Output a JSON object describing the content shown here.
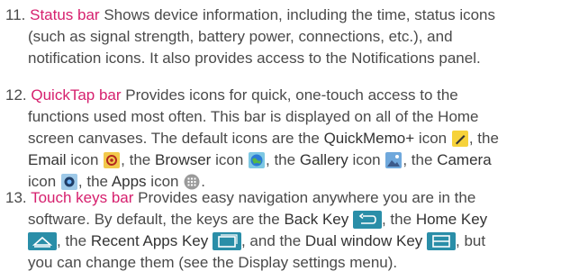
{
  "items": [
    {
      "number": "11.",
      "term": "Status bar",
      "lines": [
        "Shows device information, including the time, status icons",
        "(such as signal strength, battery power, connections, etc.), and",
        "notification icons. It also provides access to the Notifications panel."
      ]
    },
    {
      "number": "12.",
      "term": "QuickTap bar",
      "line1": "Provides icons for quick, one-touch access to the",
      "line2": "functions used most often. This bar is displayed on all of the Home",
      "line3": "screen canvases. The default icons are the",
      "quickmemo": "QuickMemo+",
      "icon_word": "icon",
      "the1": ", the",
      "email": "Email",
      "the2": ", the",
      "browser": "Browser",
      "the3": ", the",
      "gallery": "Gallery",
      "the4": ", the",
      "camera": "Camera",
      "the5": ", the",
      "apps": "Apps",
      "period": "."
    },
    {
      "number": "13.",
      "term": "Touch keys bar",
      "line1": "Provides easy navigation anywhere you are in the",
      "line2_start": "software. By default, the keys are the",
      "back_key": "Back Key",
      "the_a": ", the",
      "home_key": "Home Key",
      "the_b": ", the",
      "recent_key": "Recent Apps Key",
      "and_the": ", and the",
      "dual_key": "Dual window Key",
      "but": ", but",
      "line5": "you can change them (see the Display settings menu)."
    }
  ],
  "colors": {
    "term": "#d6206e",
    "text": "#4a4a4a",
    "key_bg": "#2a8ea8"
  }
}
